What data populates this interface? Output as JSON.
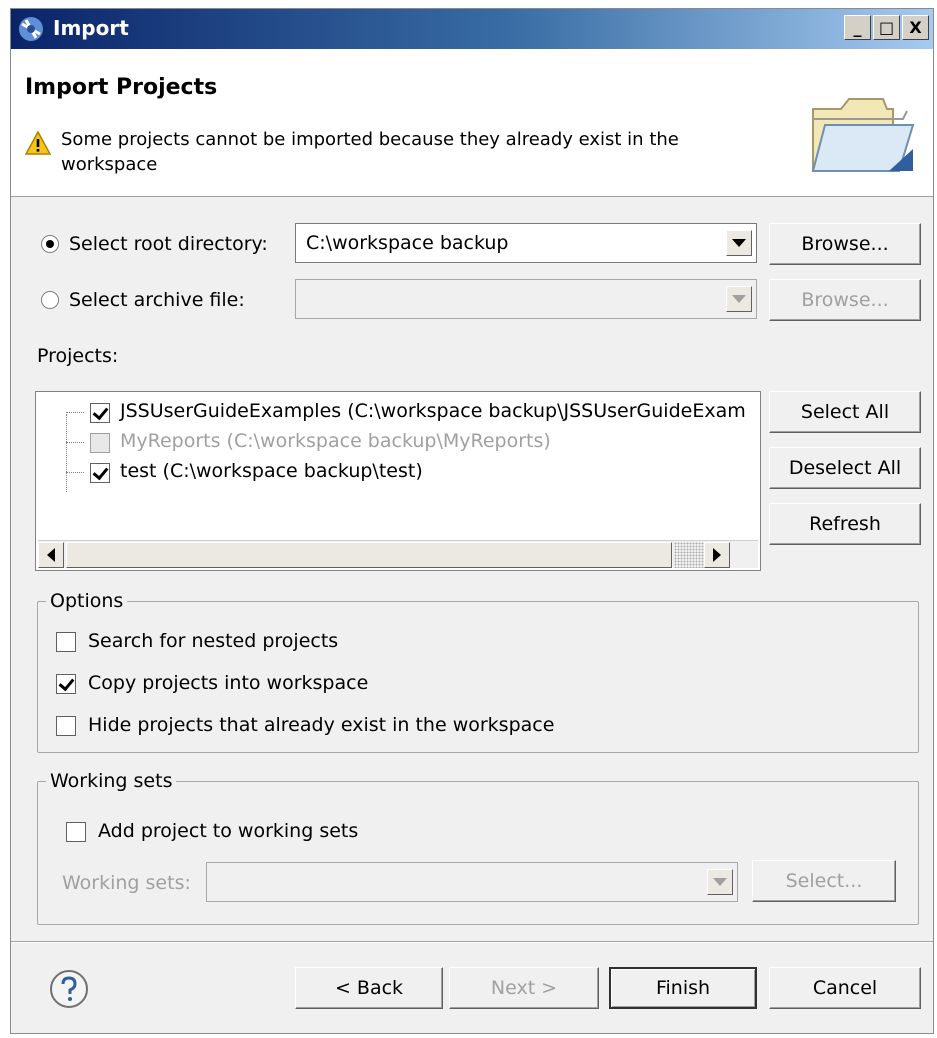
{
  "window": {
    "title": "Import",
    "controls": {
      "minimize": "_",
      "maximize": "□",
      "close": "X"
    }
  },
  "banner": {
    "heading": "Import Projects",
    "message": "Some projects cannot be imported because they already exist in the workspace",
    "icons": {
      "warning": "warning-icon",
      "folder": "open-folder-icon"
    }
  },
  "source": {
    "root": {
      "label": "Select root directory:",
      "value": "C:\\workspace backup",
      "browse": "Browse...",
      "selected": true
    },
    "archive": {
      "label": "Select archive file:",
      "value": "",
      "browse": "Browse...",
      "selected": false
    }
  },
  "projects": {
    "label": "Projects:",
    "items": [
      {
        "label": "JSSUserGuideExamples (C:\\workspace backup\\JSSUserGuideExam",
        "checked": true,
        "enabled": true
      },
      {
        "label": "MyReports (C:\\workspace backup\\MyReports)",
        "checked": false,
        "enabled": false
      },
      {
        "label": "test (C:\\workspace backup\\test)",
        "checked": true,
        "enabled": true
      }
    ],
    "buttons": {
      "select_all": "Select All",
      "deselect_all": "Deselect All",
      "refresh": "Refresh"
    }
  },
  "options": {
    "title": "Options",
    "search_nested": {
      "label": "Search for nested projects",
      "checked": false
    },
    "copy_into": {
      "label": "Copy projects into workspace",
      "checked": true
    },
    "hide_existing": {
      "label": "Hide projects that already exist in the workspace",
      "checked": false
    }
  },
  "working_sets": {
    "title": "Working sets",
    "add": {
      "label": "Add project to working sets",
      "checked": false
    },
    "field_label": "Working sets:",
    "value": "",
    "select": "Select..."
  },
  "footer": {
    "back": "< Back",
    "next": "Next >",
    "finish": "Finish",
    "cancel": "Cancel"
  }
}
